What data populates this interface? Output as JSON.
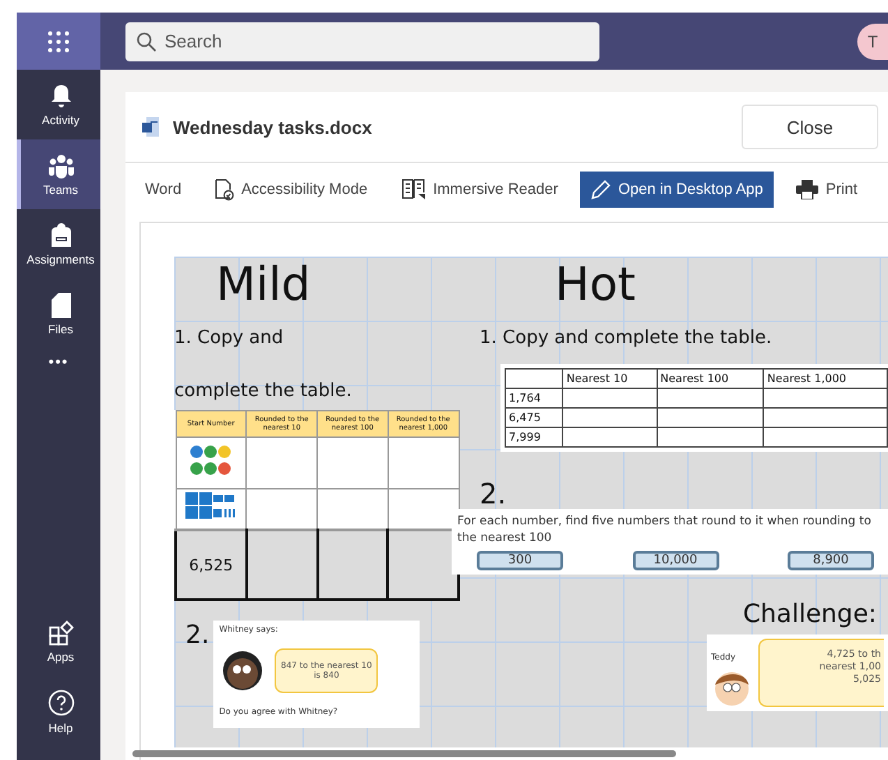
{
  "rail": {
    "top_items": [
      {
        "kind": "bell",
        "label": "Activity",
        "selected": false
      },
      {
        "kind": "teams",
        "label": "Teams",
        "selected": true
      },
      {
        "kind": "backpack",
        "label": "Assignments",
        "selected": false
      },
      {
        "kind": "file",
        "label": "Files",
        "selected": false
      }
    ],
    "more": "•••",
    "bottom_items": [
      {
        "kind": "apps",
        "label": "Apps",
        "selected": false
      },
      {
        "kind": "help",
        "label": "Help",
        "selected": false
      }
    ]
  },
  "search": {
    "placeholder": "Search"
  },
  "avatar": "T",
  "document": {
    "title": "Wednesday tasks.docx",
    "close": "Close",
    "toolbar": [
      {
        "kind": "text",
        "label": "Word",
        "primary": false
      },
      {
        "kind": "accessibility",
        "label": "Accessibility Mode",
        "primary": false
      },
      {
        "kind": "reader",
        "label": "Immersive Reader",
        "primary": false
      },
      {
        "kind": "pencil",
        "label": "Open in Desktop App",
        "primary": true
      },
      {
        "kind": "print",
        "label": "Print",
        "primary": false
      }
    ],
    "page": {
      "mild": {
        "heading": "Mild",
        "task_1": [
          "1. Copy and",
          "complete the table."
        ],
        "table": {
          "columns": [
            "Start Number",
            "Rounded to the nearest 10",
            "Rounded to the nearest 100",
            "Rounded to the nearest 1,000"
          ],
          "rows": [
            {
              "kind": "counters"
            },
            {
              "kind": "blocks"
            },
            {
              "kind": "number",
              "start": "6,525"
            }
          ]
        },
        "task_2": {
          "number": "2.",
          "caption": "Whitney says:",
          "speech": "847 to the nearest 10 is 840",
          "question": "Do you agree with Whitney?"
        }
      },
      "hot": {
        "heading": "Hot",
        "task_1": "1. Copy and complete the table.",
        "table": {
          "columns": [
            "Nearest 10",
            "Nearest 100",
            "Nearest 1,000"
          ],
          "rows": [
            "1,764",
            "6,475",
            "7,999"
          ]
        },
        "task_2": {
          "number": "2.",
          "instruction": "For each number, find five numbers that round to it when rounding to the nearest 100",
          "targets": [
            "300",
            "10,000",
            "8,900"
          ]
        },
        "challenge": {
          "heading": "Challenge:",
          "caption": "Teddy",
          "speech": [
            "4,725 to th",
            "nearest 1,00",
            "5,025"
          ]
        }
      }
    }
  }
}
